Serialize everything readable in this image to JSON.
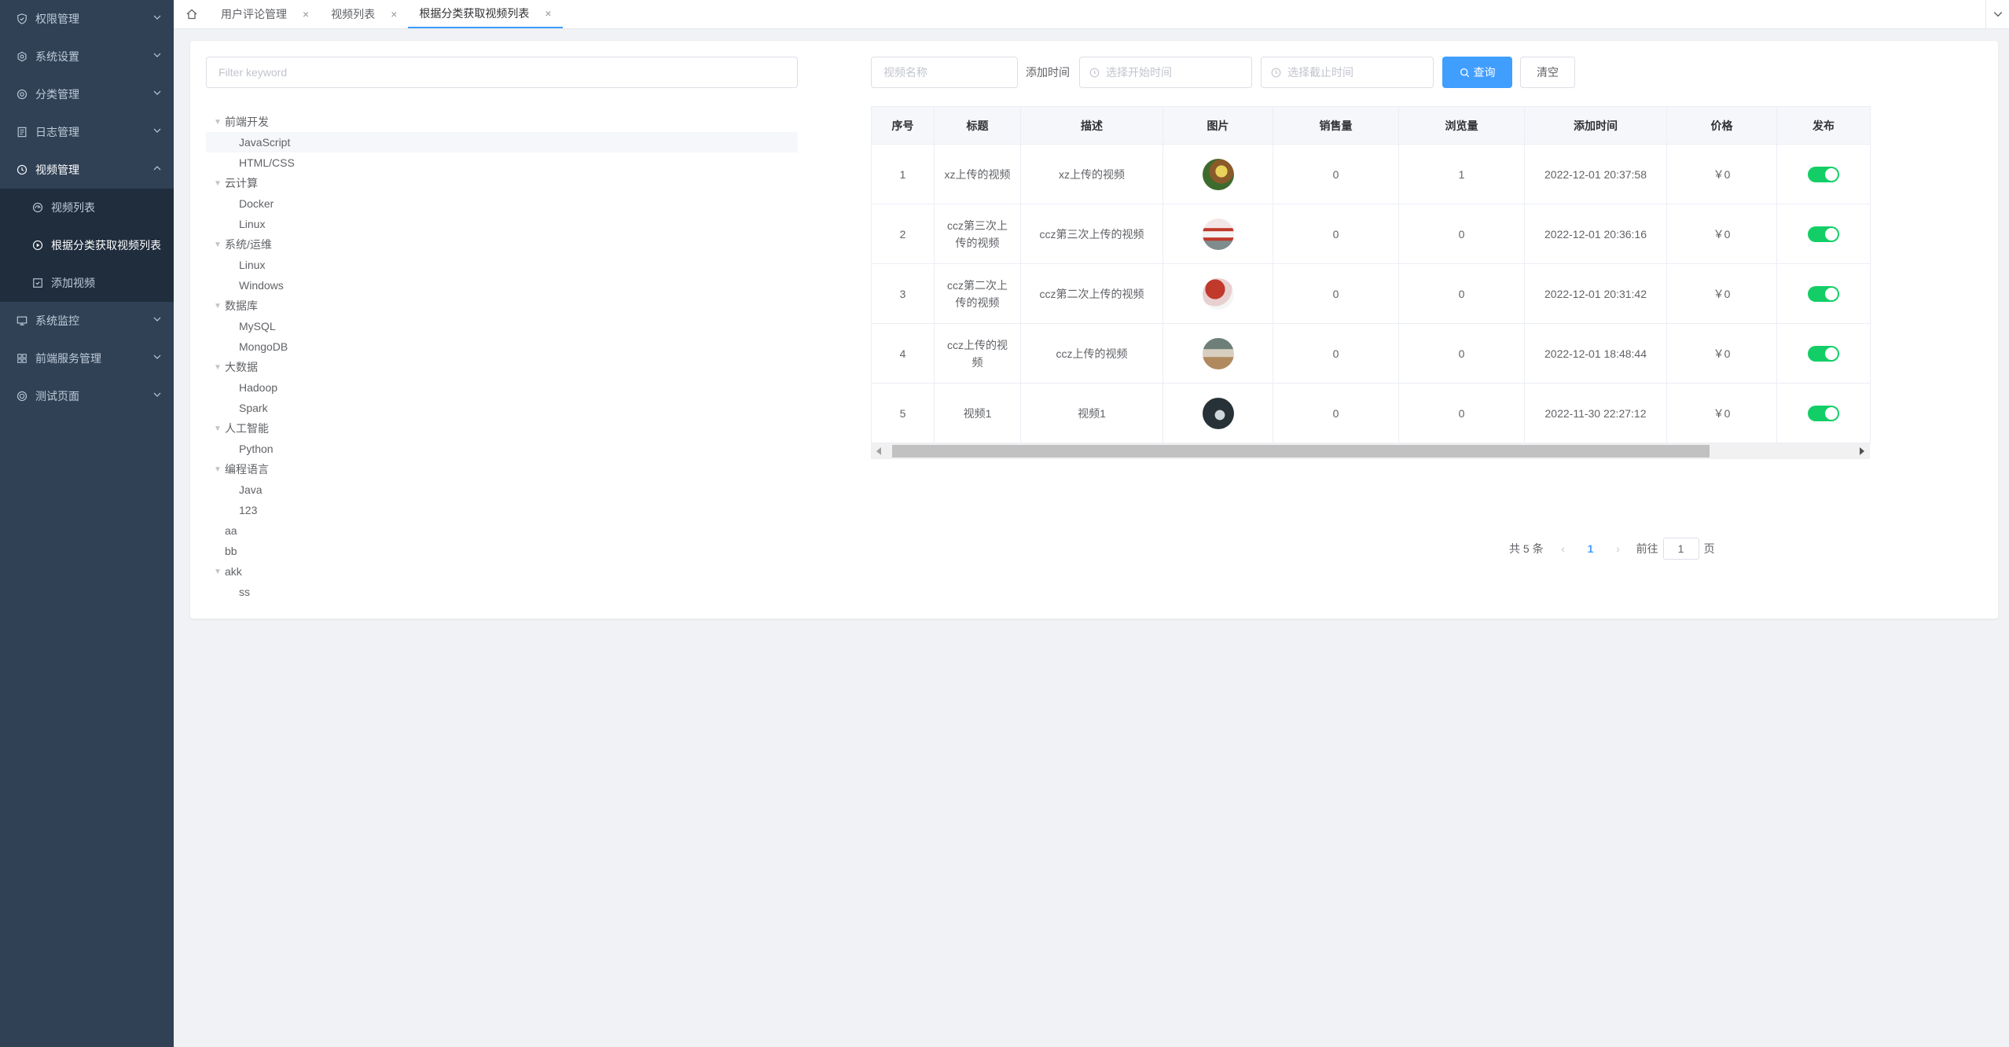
{
  "sidebar": {
    "items": [
      {
        "label": "权限管理",
        "icon": "shield-icon"
      },
      {
        "label": "系统设置",
        "icon": "gear-icon"
      },
      {
        "label": "分类管理",
        "icon": "category-icon"
      },
      {
        "label": "日志管理",
        "icon": "document-icon"
      },
      {
        "label": "视频管理",
        "icon": "clock-icon"
      },
      {
        "label": "系统监控",
        "icon": "monitor-icon"
      },
      {
        "label": "前端服务管理",
        "icon": "grid-icon"
      },
      {
        "label": "测试页面",
        "icon": "circle-icon"
      }
    ],
    "video_submenu": [
      {
        "label": "视频列表",
        "icon": "dashboard-icon"
      },
      {
        "label": "根据分类获取视频列表",
        "icon": "play-circle-icon"
      },
      {
        "label": "添加视频",
        "icon": "add-square-icon"
      }
    ]
  },
  "tabs": [
    {
      "label": "用户评论管理"
    },
    {
      "label": "视频列表"
    },
    {
      "label": "根据分类获取视频列表"
    }
  ],
  "tree": {
    "filter_placeholder": "Filter keyword",
    "nodes": [
      {
        "label": "前端开发",
        "children": [
          "JavaScript",
          "HTML/CSS"
        ]
      },
      {
        "label": "云计算",
        "children": [
          "Docker",
          "Linux"
        ]
      },
      {
        "label": "系统/运维",
        "children": [
          "Linux",
          "Windows"
        ]
      },
      {
        "label": "数据库",
        "children": [
          "MySQL",
          "MongoDB"
        ]
      },
      {
        "label": "大数据",
        "children": [
          "Hadoop",
          "Spark"
        ]
      },
      {
        "label": "人工智能",
        "children": [
          "Python"
        ]
      },
      {
        "label": "编程语言",
        "children": [
          "Java",
          "123"
        ]
      },
      {
        "label": "aa",
        "children": []
      },
      {
        "label": "bb",
        "children": []
      },
      {
        "label": "akk",
        "children": [
          "ss"
        ]
      }
    ]
  },
  "search": {
    "name_placeholder": "视频名称",
    "time_label": "添加时间",
    "start_placeholder": "选择开始时间",
    "end_placeholder": "选择截止时间",
    "query_label": "查询",
    "clear_label": "清空"
  },
  "table": {
    "headers": [
      "序号",
      "标题",
      "描述",
      "图片",
      "销售量",
      "浏览量",
      "添加时间",
      "价格",
      "发布"
    ],
    "rows": [
      {
        "no": "1",
        "title": "xz上传的视频",
        "desc": "xz上传的视频",
        "sales": "0",
        "views": "1",
        "time": "2022-12-01 20:37:58",
        "price": "￥0",
        "published": true
      },
      {
        "no": "2",
        "title": "ccz第三次上传的视频",
        "desc": "ccz第三次上传的视频",
        "sales": "0",
        "views": "0",
        "time": "2022-12-01 20:36:16",
        "price": "￥0",
        "published": true
      },
      {
        "no": "3",
        "title": "ccz第二次上传的视频",
        "desc": "ccz第二次上传的视频",
        "sales": "0",
        "views": "0",
        "time": "2022-12-01 20:31:42",
        "price": "￥0",
        "published": true
      },
      {
        "no": "4",
        "title": "ccz上传的视频",
        "desc": "ccz上传的视频",
        "sales": "0",
        "views": "0",
        "time": "2022-12-01 18:48:44",
        "price": "￥0",
        "published": true
      },
      {
        "no": "5",
        "title": "视频1",
        "desc": "视频1",
        "sales": "0",
        "views": "0",
        "time": "2022-11-30 22:27:12",
        "price": "￥0",
        "published": true
      }
    ]
  },
  "pagination": {
    "total_text": "共 5 条",
    "current_page": "1",
    "goto_label": "前往",
    "goto_value": "1",
    "page_suffix": "页"
  },
  "colors": {
    "sidebar_bg": "#304156",
    "submenu_bg": "#1f2d3d",
    "primary": "#409eff",
    "switch_on": "#13ce66"
  }
}
